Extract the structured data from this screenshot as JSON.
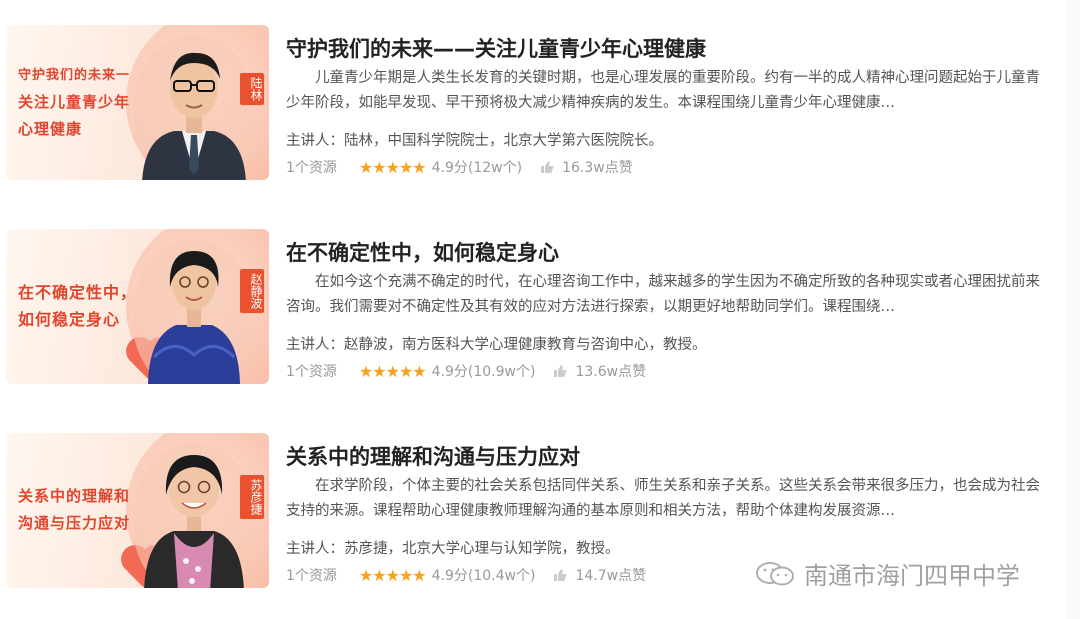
{
  "courses": [
    {
      "thumb_lines": [
        "守护我们的未来一",
        "关注儿童青少年",
        "心理健康"
      ],
      "name_tag": "陆林",
      "title": "守护我们的未来——关注儿童青少年心理健康",
      "description": "儿童青少年期是人类生长发育的关键时期，也是心理发展的重要阶段。约有一半的成人精神心理问题起始于儿童青少年阶段，如能早发现、早干预将极大减少精神疾病的发生。本课程围绕儿童青少年心理健康…",
      "speaker": "主讲人：陆林，中国科学院院士，北京大学第六医院院长。",
      "resources": "1个资源",
      "rating": "4.9分(12w个)",
      "likes": "16.3w点赞"
    },
    {
      "thumb_lines": [
        "在不确定性中，",
        "如何稳定身心"
      ],
      "name_tag": "赵静波",
      "title": "在不确定性中，如何稳定身心",
      "description": "在如今这个充满不确定的时代，在心理咨询工作中，越来越多的学生因为不确定所致的各种现实或者心理困扰前来咨询。我们需要对不确定性及其有效的应对方法进行探索，以期更好地帮助同学们。课程围绕…",
      "speaker": "主讲人：赵静波，南方医科大学心理健康教育与咨询中心，教授。",
      "resources": "1个资源",
      "rating": "4.9分(10.9w个)",
      "likes": "13.6w点赞"
    },
    {
      "thumb_lines": [
        "关系中的理解和",
        "沟通与压力应对"
      ],
      "name_tag": "苏彦捷",
      "title": "关系中的理解和沟通与压力应对",
      "description": "在求学阶段，个体主要的社会关系包括同伴关系、师生关系和亲子关系。这些关系会带来很多压力，也会成为社会支持的来源。课程帮助心理健康教师理解沟通的基本原则和相关方法，帮助个体建构发展资源…",
      "speaker": "主讲人：苏彦捷，北京大学心理与认知学院，教授。",
      "resources": "1个资源",
      "rating": "4.9分(10.4w个)",
      "likes": "14.7w点赞"
    }
  ],
  "stars": "★★★★★",
  "watermark": "南通市海门四甲中学",
  "colors": {
    "accent": "#e0462e",
    "star": "#f7a21b",
    "meta_text": "#999999"
  },
  "icons": [
    "thumbs-up-icon",
    "wechat-icon",
    "star-icon"
  ]
}
